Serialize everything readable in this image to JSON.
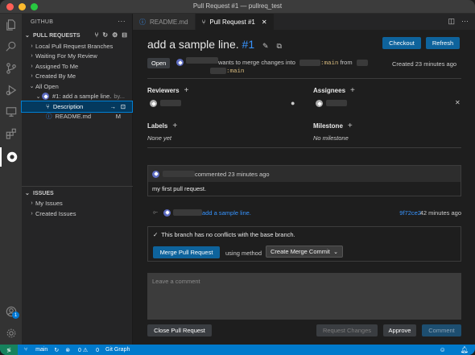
{
  "window": {
    "title": "Pull Request #1 — pullreq_test"
  },
  "sidebar": {
    "header": "GITHUB",
    "pr_section": "PULL REQUESTS",
    "pr_items": [
      {
        "label": "Local Pull Request Branches"
      },
      {
        "label": "Waiting For My Review"
      },
      {
        "label": "Assigned To Me"
      },
      {
        "label": "Created By Me"
      },
      {
        "label": "All Open"
      }
    ],
    "pr_item": {
      "label": "#1: add a sample line.",
      "suffix": "by..."
    },
    "description": "Description",
    "file": {
      "label": "README.md",
      "status": "M"
    },
    "issues_section": "ISSUES",
    "issue_items": [
      {
        "label": "My Issues"
      },
      {
        "label": "Created Issues"
      }
    ]
  },
  "tabs": [
    {
      "label": "README.md",
      "icon": "info-icon"
    },
    {
      "label": "Pull Request #1",
      "icon": "pull-request-icon"
    }
  ],
  "pr": {
    "title": "add a sample line.",
    "number": "#1",
    "checkout_label": "Checkout",
    "refresh_label": "Refresh",
    "state": "Open",
    "merge_text": "wants to merge changes into",
    "base_branch": ":main",
    "from_text": "from",
    "head_branch": ":main",
    "created": "Created 23 minutes ago",
    "reviewers_label": "Reviewers",
    "assignees_label": "Assignees",
    "labels_label": "Labels",
    "labels_value": "None yet",
    "milestone_label": "Milestone",
    "milestone_value": "No milestone",
    "comment": {
      "meta": "commented 23 minutes ago",
      "body": "my first pull request."
    },
    "commit": {
      "message": "add a sample line.",
      "sha": "9f72ce2",
      "time": "42 minutes ago"
    },
    "merge_status": "This branch has no conflicts with the base branch.",
    "merge_button": "Merge Pull Request",
    "using_method": "using method",
    "merge_method": "Create Merge Commit",
    "comment_placeholder": "Leave a comment",
    "close_button": "Close Pull Request",
    "request_changes": "Request Changes",
    "approve": "Approve",
    "comment_button": "Comment"
  },
  "statusbar": {
    "branch": "main",
    "problems": "0",
    "warnings": "0",
    "git_graph": "Git Graph"
  },
  "accounts_badge": "1",
  "colors": {
    "accent": "#0e639c",
    "statusbar": "#007acc",
    "link": "#3794ff"
  }
}
